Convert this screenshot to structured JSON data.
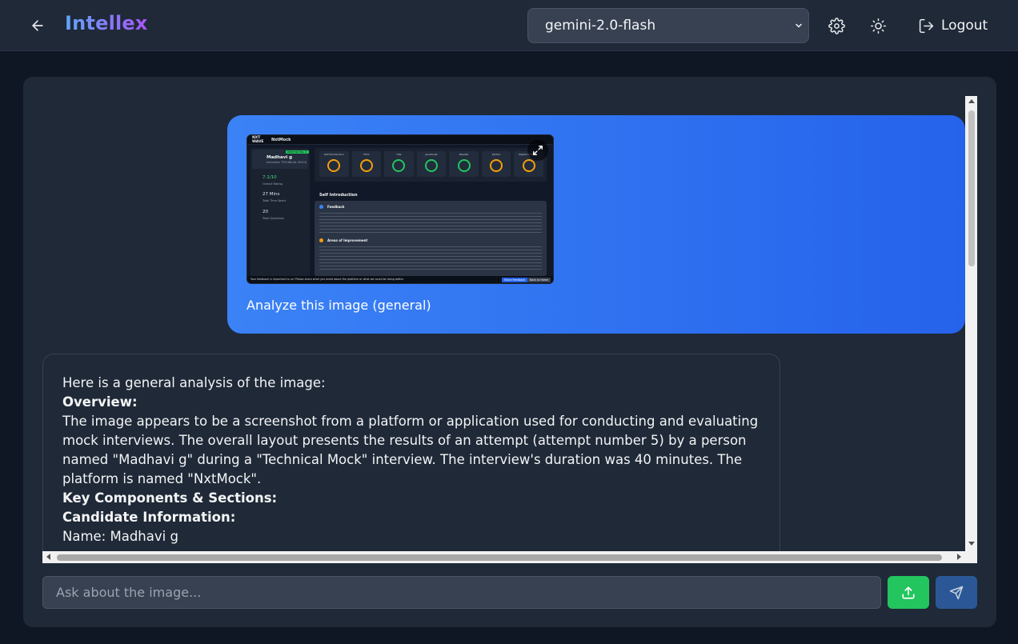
{
  "header": {
    "brand": "Intellex",
    "model_selected": "gemini-2.0-flash",
    "logout_label": "Logout"
  },
  "thumbnail": {
    "app_logo": "NXT WAVE",
    "app_name": "NxtMock",
    "candidate_name": "Madhavi g",
    "interview_label": "Interview: TECHNICAL MOCK",
    "attempt_badge": "Attempt No. 5",
    "rating": "7.1/10",
    "rating_label": "Overall Rating",
    "time": "27 Mins",
    "time_label": "Total Time Spent",
    "questions": "20",
    "questions_label": "Total Questions",
    "skills": [
      "Self Introduction",
      "Html",
      "CSS",
      "JavaScript",
      "ReactJS",
      "Python",
      "Digital Commu..."
    ],
    "section_title": "Self Introduction",
    "feedback_title": "Feedback",
    "improvement_title": "Areas of Improvement",
    "footer_text": "Your feedback is important to us! Please share what you loved about the platform or what we could be doing better.",
    "footer_btn1": "Share Feedback",
    "footer_btn2": "Back to Home"
  },
  "chat": {
    "user_message": "Analyze this image (general)",
    "assistant_lines": [
      {
        "text": "Here is a general analysis of the image:",
        "bold": false
      },
      {
        "text": "Overview:",
        "bold": true
      },
      {
        "text": "The image appears to be a screenshot from a platform or application used for conducting and evaluating mock interviews. The overall layout presents the results of an attempt (attempt number 5) by a person named \"Madhavi g\" during a \"Technical Mock\" interview. The interview's duration was 40 minutes. The platform is named \"NxtMock\".",
        "bold": false
      },
      {
        "text": "Key Components & Sections:",
        "bold": true
      },
      {
        "text": "Candidate Information:",
        "bold": true
      },
      {
        "text": "Name: Madhavi g",
        "bold": false
      }
    ]
  },
  "input": {
    "placeholder": "Ask about the image..."
  },
  "colors": {
    "accent_blue": "#3b82f6",
    "upload_green": "#22c55e",
    "send_blue": "#2b5797",
    "panel": "#1f2937",
    "background": "#0f1624"
  },
  "icons": {
    "back": "arrow-left-icon",
    "settings": "gear-icon",
    "theme": "sun-icon",
    "logout": "logout-icon",
    "upload": "upload-icon",
    "send": "send-icon",
    "expand": "expand-icon"
  }
}
